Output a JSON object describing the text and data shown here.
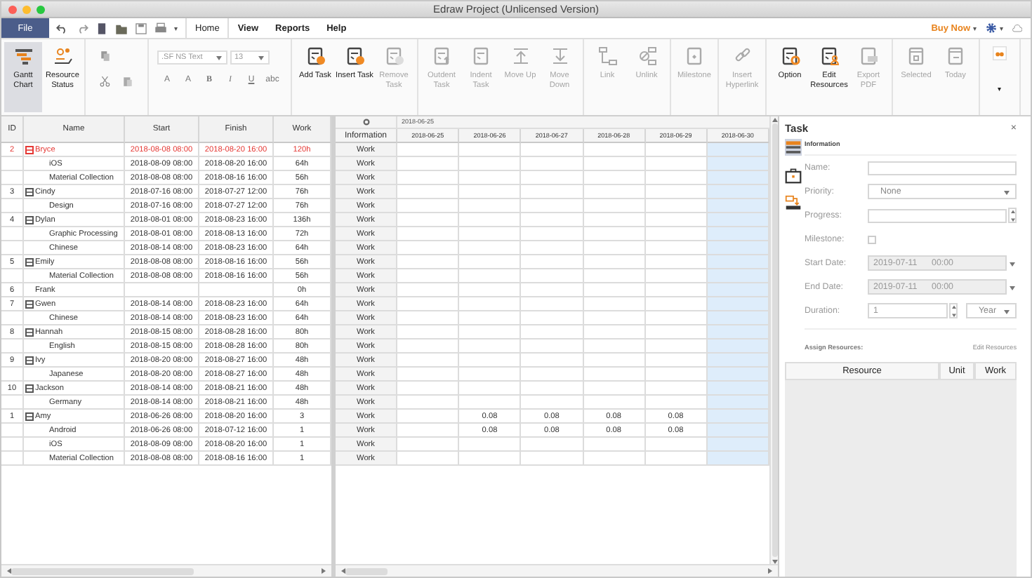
{
  "window": {
    "title": "Edraw Project (Unlicensed Version)"
  },
  "menu": {
    "file": "File",
    "quick_more": "▾",
    "tabs": [
      {
        "label": "Home",
        "selected": true
      },
      {
        "label": "View",
        "selected": false
      },
      {
        "label": "Reports",
        "selected": false
      },
      {
        "label": "Help",
        "selected": false
      }
    ],
    "buy_now": "Buy Now",
    "buy_caret": "▾",
    "gear_caret": "▾"
  },
  "ribbon": {
    "views": [
      {
        "kind": "gantt",
        "label": "Gantt Chart",
        "selected": true
      },
      {
        "kind": "resource",
        "label": "Resource Status",
        "selected": false
      }
    ],
    "font": {
      "family": ".SF NS Text",
      "size": "13",
      "format": [
        "A",
        "A",
        "B",
        "I",
        "U",
        "abc"
      ]
    },
    "groups": [
      [
        {
          "kind": "add",
          "label": "Add Task",
          "disabled": false
        },
        {
          "kind": "insert",
          "label": "Insert Task",
          "disabled": false
        },
        {
          "kind": "remove",
          "label": "Remove Task",
          "disabled": true
        }
      ],
      [
        {
          "kind": "outdent",
          "label": "Outdent Task",
          "disabled": true
        },
        {
          "kind": "indent",
          "label": "Indent Task",
          "disabled": true
        },
        {
          "kind": "up",
          "label": "Move Up",
          "disabled": true
        },
        {
          "kind": "down",
          "label": "Move Down",
          "disabled": true
        }
      ],
      [
        {
          "kind": "link",
          "label": "Link",
          "disabled": true
        },
        {
          "kind": "unlink",
          "label": "Unlink",
          "disabled": true
        }
      ],
      [
        {
          "kind": "milestone",
          "label": "Milestone",
          "disabled": true
        }
      ],
      [
        {
          "kind": "hyperlink",
          "label": "Insert Hyperlink",
          "disabled": true
        }
      ],
      [
        {
          "kind": "option",
          "label": "Option",
          "disabled": false
        },
        {
          "kind": "resources",
          "label": "Edit Resources",
          "disabled": false
        },
        {
          "kind": "pdf",
          "label": "Export PDF",
          "disabled": true
        }
      ],
      [
        {
          "kind": "selected",
          "label": "Selected",
          "disabled": true
        },
        {
          "kind": "today",
          "label": "Today",
          "disabled": true
        }
      ],
      [
        {
          "kind": "more",
          "label": "▾",
          "disabled": false
        }
      ]
    ]
  },
  "table": {
    "columns": [
      "ID",
      "Name",
      "Start",
      "Finish",
      "Work"
    ],
    "tasks": [
      {
        "id": "2",
        "name": "Bryce",
        "start": "2018-08-08 08:00",
        "finish": "2018-08-20 16:00",
        "work": "120h",
        "selected": true,
        "expanded": true,
        "information": "Work",
        "children": [
          {
            "name": "iOS",
            "start": "2018-08-09 08:00",
            "finish": "2018-08-20 16:00",
            "work": "64h",
            "selected": false,
            "information": "Work"
          },
          {
            "name": "Material Collection",
            "start": "2018-08-08 08:00",
            "finish": "2018-08-16 16:00",
            "work": "56h",
            "selected": false,
            "information": "Work"
          }
        ]
      },
      {
        "id": "3",
        "name": "Cindy",
        "start": "2018-07-16 08:00",
        "finish": "2018-07-27 12:00",
        "work": "76h",
        "selected": false,
        "expanded": true,
        "information": "Work",
        "children": [
          {
            "name": "Design",
            "start": "2018-07-16 08:00",
            "finish": "2018-07-27 12:00",
            "work": "76h",
            "selected": false,
            "information": "Work"
          }
        ]
      },
      {
        "id": "4",
        "name": "Dylan",
        "start": "2018-08-01 08:00",
        "finish": "2018-08-23 16:00",
        "work": "136h",
        "selected": false,
        "expanded": true,
        "information": "Work",
        "children": [
          {
            "name": "Graphic Processing",
            "start": "2018-08-01 08:00",
            "finish": "2018-08-13 16:00",
            "work": "72h",
            "selected": false,
            "information": "Work"
          },
          {
            "name": "Chinese",
            "start": "2018-08-14 08:00",
            "finish": "2018-08-23 16:00",
            "work": "64h",
            "selected": false,
            "information": "Work"
          }
        ]
      },
      {
        "id": "5",
        "name": "Emily",
        "start": "2018-08-08 08:00",
        "finish": "2018-08-16 16:00",
        "work": "56h",
        "selected": false,
        "expanded": true,
        "information": "Work",
        "children": [
          {
            "name": "Material Collection",
            "start": "2018-08-08 08:00",
            "finish": "2018-08-16 16:00",
            "work": "56h",
            "selected": false,
            "information": "Work"
          }
        ]
      },
      {
        "id": "6",
        "name": "Frank",
        "work": "0h",
        "selected": false,
        "information": "Work"
      },
      {
        "id": "7",
        "name": "Gwen",
        "start": "2018-08-14 08:00",
        "finish": "2018-08-23 16:00",
        "work": "64h",
        "selected": false,
        "expanded": true,
        "information": "Work",
        "children": [
          {
            "name": "Chinese",
            "start": "2018-08-14 08:00",
            "finish": "2018-08-23 16:00",
            "work": "64h",
            "selected": false,
            "information": "Work"
          }
        ]
      },
      {
        "id": "8",
        "name": "Hannah",
        "start": "2018-08-15 08:00",
        "finish": "2018-08-28 16:00",
        "work": "80h",
        "selected": false,
        "expanded": true,
        "information": "Work",
        "children": [
          {
            "name": "English",
            "start": "2018-08-15 08:00",
            "finish": "2018-08-28 16:00",
            "work": "80h",
            "selected": false,
            "information": "Work"
          }
        ]
      },
      {
        "id": "9",
        "name": "Ivy",
        "start": "2018-08-20 08:00",
        "finish": "2018-08-27 16:00",
        "work": "48h",
        "selected": false,
        "expanded": true,
        "information": "Work",
        "children": [
          {
            "name": "Japanese",
            "start": "2018-08-20 08:00",
            "finish": "2018-08-27 16:00",
            "work": "48h",
            "selected": false,
            "information": "Work"
          }
        ]
      },
      {
        "id": "10",
        "name": "Jackson",
        "start": "2018-08-14 08:00",
        "finish": "2018-08-21 16:00",
        "work": "48h",
        "selected": false,
        "expanded": true,
        "information": "Work",
        "children": [
          {
            "name": "Germany",
            "start": "2018-08-14 08:00",
            "finish": "2018-08-21 16:00",
            "work": "48h",
            "selected": false,
            "information": "Work"
          }
        ]
      },
      {
        "id": "1",
        "name": "Amy",
        "start": "2018-06-26 08:00",
        "finish": "2018-08-20 16:00",
        "work": "3",
        "selected": false,
        "expanded": true,
        "information": "Work",
        "values": [
          {
            "kind": "blank"
          },
          {
            "kind": "value",
            "text": "0.08"
          },
          {
            "kind": "value",
            "text": "0.08"
          },
          {
            "kind": "value",
            "text": "0.08"
          },
          {
            "kind": "value",
            "text": "0.08"
          },
          {
            "kind": "blank"
          }
        ],
        "children": [
          {
            "name": "Android",
            "start": "2018-06-26 08:00",
            "finish": "2018-07-12 16:00",
            "work": "1",
            "selected": false,
            "information": "Work",
            "values": [
              {
                "kind": "blank"
              },
              {
                "kind": "value",
                "text": "0.08"
              },
              {
                "kind": "value",
                "text": "0.08"
              },
              {
                "kind": "value",
                "text": "0.08"
              },
              {
                "kind": "value",
                "text": "0.08"
              },
              {
                "kind": "blank"
              }
            ]
          },
          {
            "name": "iOS",
            "start": "2018-08-09 08:00",
            "finish": "2018-08-20 16:00",
            "work": "1",
            "selected": false,
            "information": "Work"
          },
          {
            "name": "Material Collection",
            "start": "2018-08-08 08:00",
            "finish": "2018-08-16 16:00",
            "work": "1",
            "selected": false,
            "information": "Work"
          }
        ]
      }
    ]
  },
  "gantt": {
    "week": "2018-06-25",
    "info_header": "Information",
    "days": [
      {
        "label": "2018-06-25",
        "today": false
      },
      {
        "label": "2018-06-26",
        "today": false
      },
      {
        "label": "2018-06-27",
        "today": false
      },
      {
        "label": "2018-06-28",
        "today": false
      },
      {
        "label": "2018-06-29",
        "today": false
      },
      {
        "label": "2018-06-30",
        "today": true
      }
    ]
  },
  "task_panel": {
    "title": "Task",
    "close": "×",
    "section": "Information",
    "fields": [
      {
        "kind": "text",
        "label": "Name:"
      },
      {
        "kind": "select",
        "label": "Priority:",
        "value": "None"
      },
      {
        "kind": "spin",
        "label": "Progress:"
      },
      {
        "kind": "check",
        "label": "Milestone:",
        "checked": false
      },
      {
        "kind": "date",
        "label": "Start Date:",
        "value": "2019-07-11      00:00"
      },
      {
        "kind": "date",
        "label": "End Date:",
        "value": "2019-07-11      00:00"
      },
      {
        "kind": "duration",
        "label": "Duration:",
        "value": "1",
        "unit": "Year"
      }
    ],
    "assign": "Assign Resources:",
    "edit_link": "Edit Resources",
    "resource_columns": [
      "Resource",
      "Unit",
      "Work"
    ]
  }
}
